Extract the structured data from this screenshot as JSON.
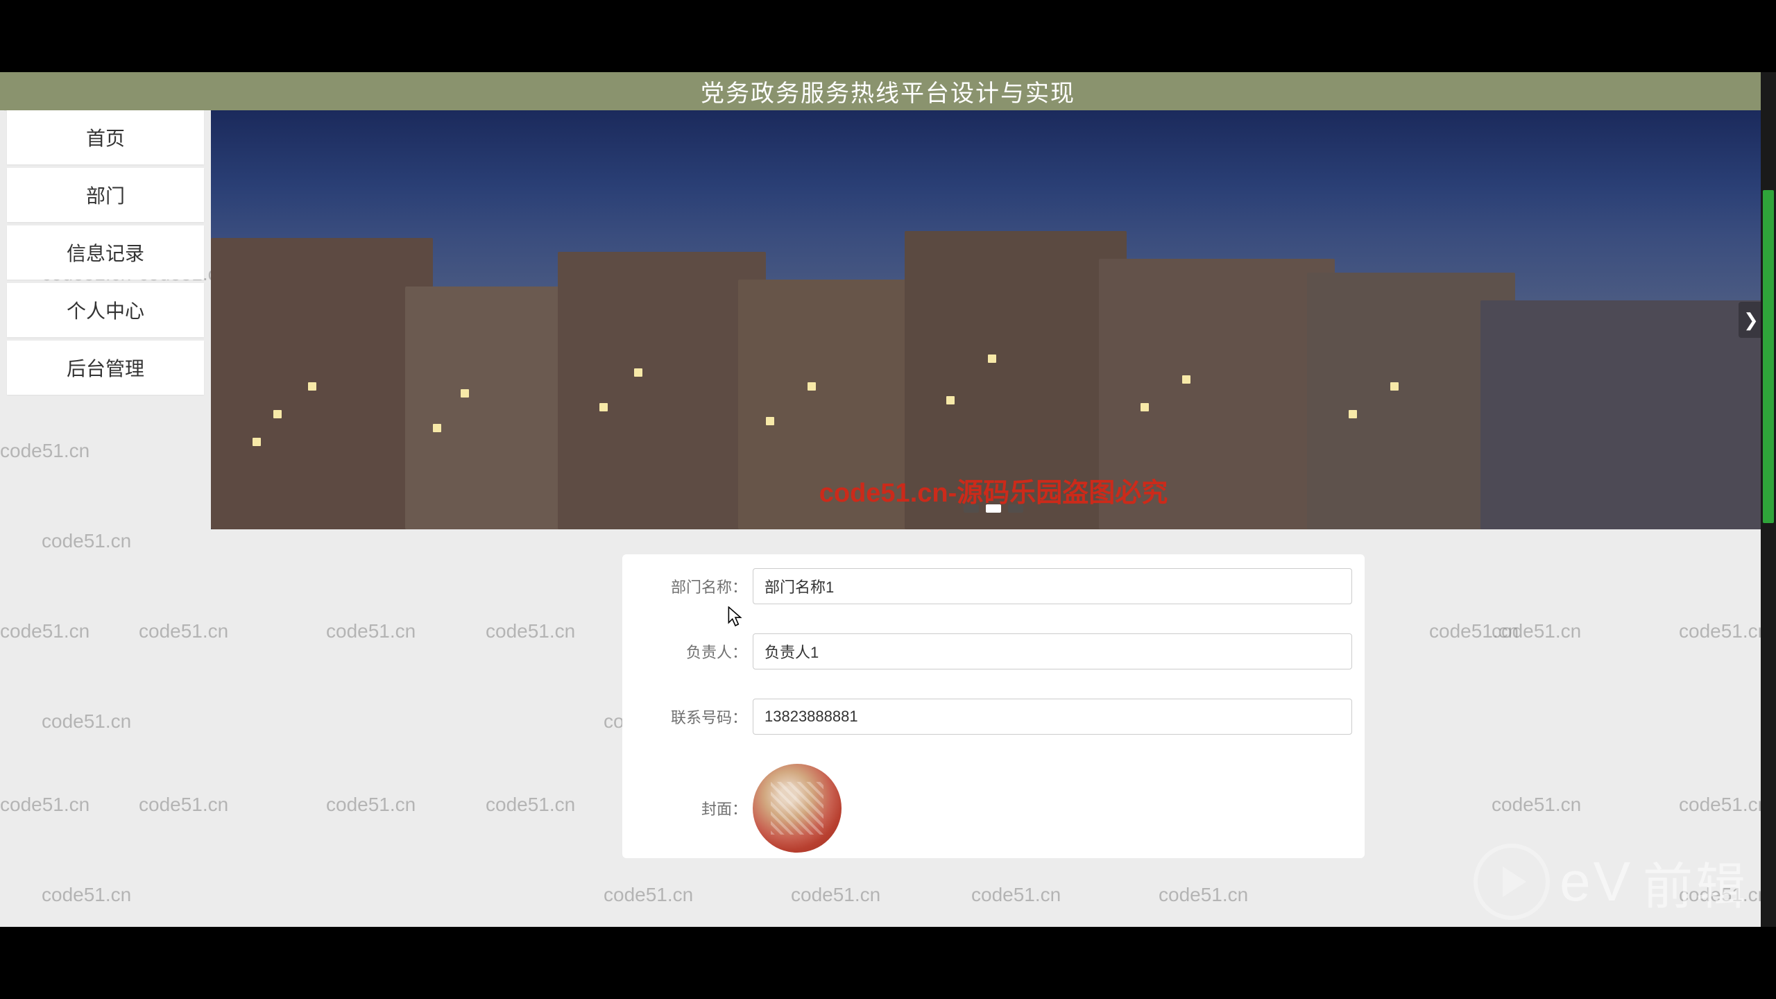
{
  "header": {
    "title": "党务政务服务热线平台设计与实现"
  },
  "watermark": {
    "text": "code51.cn",
    "caption_center": "code51.cn-源码乐园盗图必究"
  },
  "sidebar": {
    "items": [
      {
        "label": "首页"
      },
      {
        "label": "部门"
      },
      {
        "label": "信息记录"
      },
      {
        "label": "个人中心"
      },
      {
        "label": "后台管理"
      }
    ],
    "active_index": 1
  },
  "form": {
    "dept_name": {
      "label": "部门名称：",
      "value": "部门名称1"
    },
    "owner": {
      "label": "负责人：",
      "value": "负责人1"
    },
    "phone": {
      "label": "联系号码：",
      "value": "13823888881"
    },
    "cover": {
      "label": "封面："
    }
  },
  "carousel": {
    "active_dot": 1,
    "dot_count": 3
  },
  "logo": {
    "brand": "eV",
    "suffix": "前辑"
  }
}
